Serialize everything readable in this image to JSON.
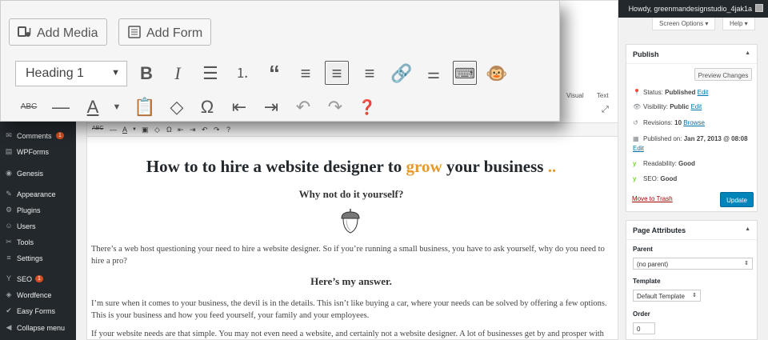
{
  "admin_bar": {
    "howdy": "Howdy, greenmandesignstudio_4jak1a"
  },
  "screen_options": {
    "screen_options_label": "Screen Options ▾",
    "help_label": "Help ▾"
  },
  "toolbar": {
    "add_media_label": "Add Media",
    "add_form_label": "Add Form",
    "format_select": "Heading 1"
  },
  "editor_tabs": {
    "visual": "Visual",
    "text": "Text"
  },
  "menu": {
    "items": [
      {
        "label": "Comments",
        "badge": "1",
        "icon": "comments-icon"
      },
      {
        "label": "WPForms",
        "badge": "",
        "icon": "wpforms-icon"
      },
      {
        "label": "Genesis",
        "badge": "",
        "icon": "genesis-icon"
      },
      {
        "label": "Appearance",
        "badge": "",
        "icon": "appearance-icon"
      },
      {
        "label": "Plugins",
        "badge": "",
        "icon": "plugins-icon"
      },
      {
        "label": "Users",
        "badge": "",
        "icon": "users-icon"
      },
      {
        "label": "Tools",
        "badge": "",
        "icon": "tools-icon"
      },
      {
        "label": "Settings",
        "badge": "",
        "icon": "settings-icon"
      },
      {
        "label": "SEO",
        "badge": "1",
        "icon": "seo-icon"
      },
      {
        "label": "Wordfence",
        "badge": "",
        "icon": "wordfence-icon"
      },
      {
        "label": "Easy Forms",
        "badge": "",
        "icon": "easy-forms-icon"
      },
      {
        "label": "Collapse menu",
        "badge": "",
        "icon": "collapse-icon"
      }
    ]
  },
  "post": {
    "title_a": "How to to hire a website designer to ",
    "title_hl": "grow",
    "title_b": " your business ",
    "title_dots": "..",
    "heading1": "Why not do it yourself?",
    "para1": "There’s a web host questioning your need to hire a website designer. So if you’re running a small business, you have to ask yourself, why do you need to hire a pro?",
    "heading2": "Here’s my answer.",
    "para2": "I’m sure when it comes to your business, the devil is in the details. This isn’t like buying a car, where your needs can be solved by offering a few options. This is your business and how you feed yourself, your family and your employees.",
    "para3": "If your website needs are that simple. You may not even need a website, and certainly not a website designer. A lot of businesses get by and prosper with"
  },
  "publish": {
    "title": "Publish",
    "preview_label": "Preview Changes",
    "status_label": "Status:",
    "status_value": "Published",
    "edit1": "Edit",
    "visibility_label": "Visibility:",
    "visibility_value": "Public",
    "edit2": "Edit",
    "revisions_label": "Revisions:",
    "revisions_value": "10",
    "browse": "Browse",
    "published_label": "Published on:",
    "published_value": "Jan 27, 2013 @ 08:08",
    "edit3": "Edit",
    "readability_label": "Readability:",
    "readability_value": "Good",
    "seo_label": "SEO:",
    "seo_value": "Good",
    "trash_label": "Move to Trash",
    "update_label": "Update"
  },
  "page_attributes": {
    "title": "Page Attributes",
    "parent_label": "Parent",
    "parent_value": "(no parent)",
    "template_label": "Template",
    "template_value": "Default Template",
    "order_label": "Order",
    "order_value": "0"
  },
  "colors": {
    "accent": "#0085ba",
    "highlight": "#e69a2e",
    "admin_bg": "#23282d"
  }
}
